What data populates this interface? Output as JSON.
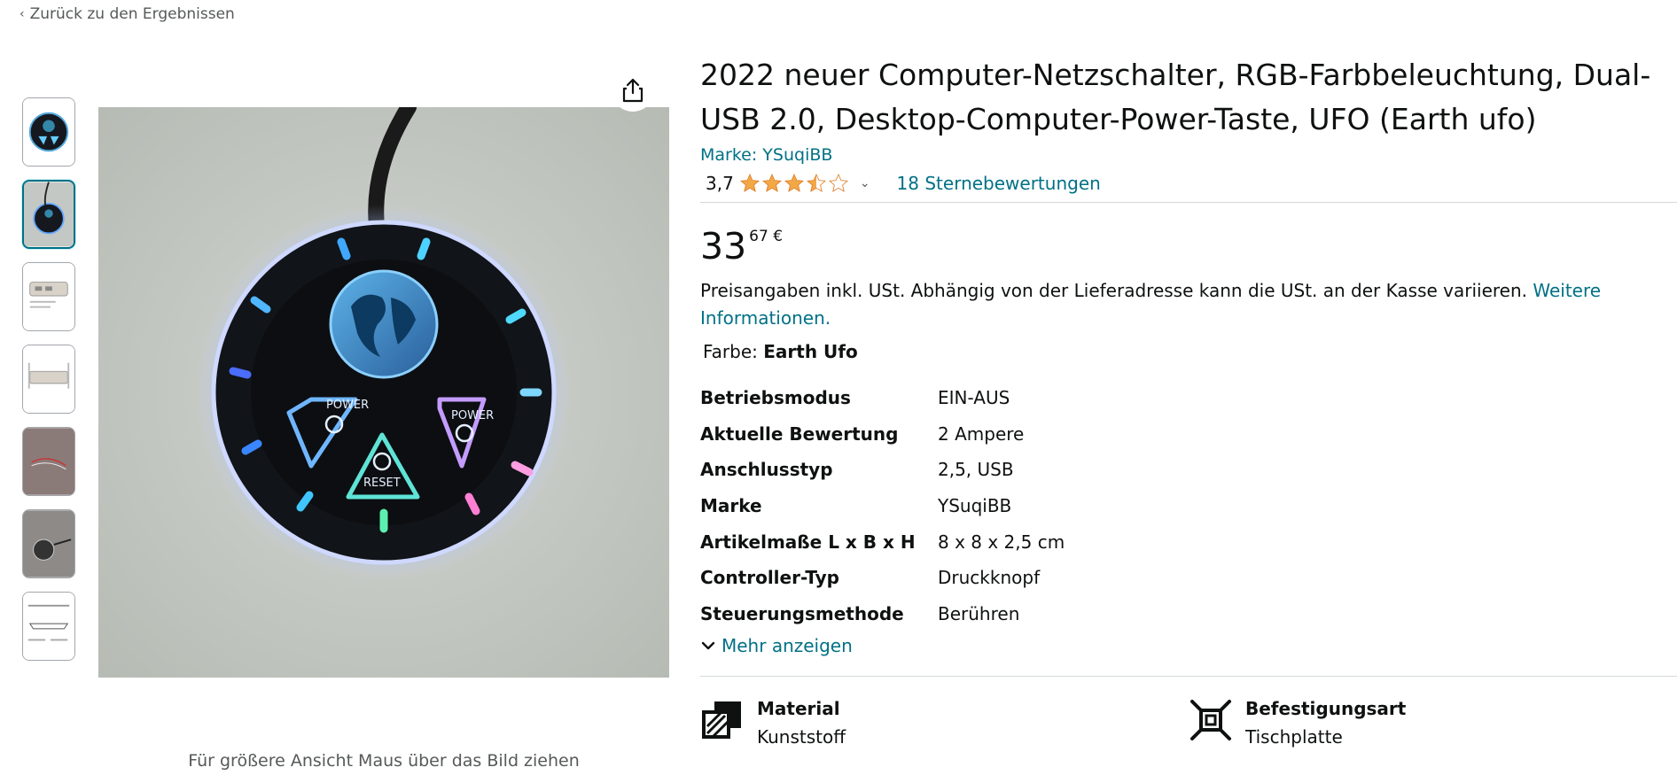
{
  "nav": {
    "back_label": "Zurück zu den Ergebnissen"
  },
  "gallery": {
    "thumbnails": [
      {
        "name": "thumb-1"
      },
      {
        "name": "thumb-2"
      },
      {
        "name": "thumb-3"
      },
      {
        "name": "thumb-4"
      },
      {
        "name": "thumb-5"
      },
      {
        "name": "thumb-6"
      },
      {
        "name": "thumb-7"
      }
    ],
    "selected_index": 1,
    "zoom_hint": "Für größere Ansicht Maus über das Bild ziehen",
    "image_labels": {
      "power_left": "POWER",
      "power_right": "POWER",
      "reset": "RESET"
    }
  },
  "product": {
    "title": "2022 neuer Computer-Netzschalter, RGB-Farbbeleuchtung, Dual-USB 2.0, Desktop-Computer-Power-Taste, UFO (Earth ufo)",
    "brand_label": "Marke: YSuqiBB",
    "rating": {
      "value": "3,7",
      "stars": 3.5,
      "count_label": "18 Sternebewertungen"
    },
    "price": {
      "whole": "33",
      "fraction": "67",
      "currency": "€"
    },
    "tax_note": "Preisangaben inkl. USt. Abhängig von der Lieferadresse kann die USt. an der Kasse variieren. ",
    "tax_link": "Weitere Informationen.",
    "color": {
      "label": "Farbe: ",
      "value": "Earth Ufo"
    },
    "specs": [
      {
        "key": "Betriebsmodus",
        "value": "EIN-AUS"
      },
      {
        "key": "Aktuelle Bewertung",
        "value": "2 Ampere"
      },
      {
        "key": "Anschlusstyp",
        "value": "2,5, USB"
      },
      {
        "key": "Marke",
        "value": "YSuqiBB"
      },
      {
        "key": "Artikelmaße L x B x H",
        "value": "8 x 8 x 2,5 cm"
      },
      {
        "key": "Controller-Typ",
        "value": "Druckknopf"
      },
      {
        "key": "Steuerungsmethode",
        "value": "Berühren"
      }
    ],
    "more_label": "Mehr anzeigen",
    "features": [
      {
        "icon": "material-icon",
        "key": "Material",
        "value": "Kunststoff"
      },
      {
        "icon": "mounting-icon",
        "key": "Befestigungsart",
        "value": "Tischplatte"
      }
    ]
  },
  "colors": {
    "link": "#007185",
    "star": "#f3a847",
    "text": "#0f1111",
    "muted": "#565959"
  }
}
